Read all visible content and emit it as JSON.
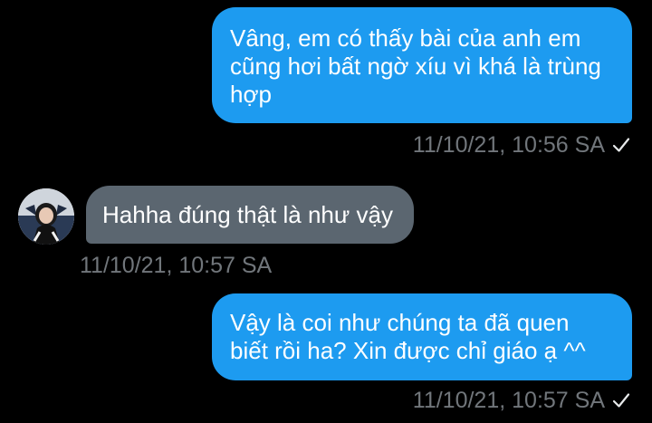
{
  "conversation": {
    "messages": [
      {
        "direction": "outgoing",
        "text": "Vâng, em có thấy bài của anh em\ncũng hơi bất ngờ xíu vì khá là trùng\nhợp",
        "timestamp": "11/10/21, 10:56 SA",
        "status_icon": "check-icon"
      },
      {
        "direction": "incoming",
        "text": "Hahha đúng thật là như vậy",
        "timestamp": "11/10/21, 10:57 SA",
        "avatar_icon": "avatar"
      },
      {
        "direction": "outgoing",
        "text": "Vậy là coi như chúng ta đã quen\nbiết rồi ha? Xin được chỉ giáo ạ ^^",
        "timestamp": "11/10/21, 10:57 SA",
        "status_icon": "check-icon"
      }
    ]
  },
  "colors": {
    "background": "#000000",
    "outgoing_bubble": "#1d9bf0",
    "incoming_bubble": "#5b6670",
    "timestamp": "#71767b",
    "text": "#ffffff"
  }
}
